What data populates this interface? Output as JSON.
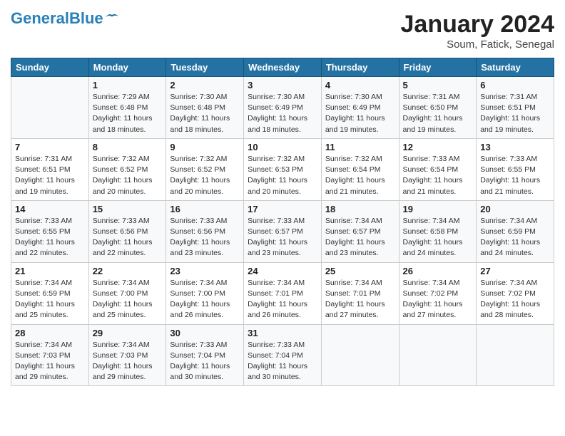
{
  "header": {
    "logo_line1": "General",
    "logo_line2": "Blue",
    "title": "January 2024",
    "subtitle": "Soum, Fatick, Senegal"
  },
  "weekdays": [
    "Sunday",
    "Monday",
    "Tuesday",
    "Wednesday",
    "Thursday",
    "Friday",
    "Saturday"
  ],
  "weeks": [
    [
      {
        "day": "",
        "info": ""
      },
      {
        "day": "1",
        "info": "Sunrise: 7:29 AM\nSunset: 6:48 PM\nDaylight: 11 hours\nand 18 minutes."
      },
      {
        "day": "2",
        "info": "Sunrise: 7:30 AM\nSunset: 6:48 PM\nDaylight: 11 hours\nand 18 minutes."
      },
      {
        "day": "3",
        "info": "Sunrise: 7:30 AM\nSunset: 6:49 PM\nDaylight: 11 hours\nand 18 minutes."
      },
      {
        "day": "4",
        "info": "Sunrise: 7:30 AM\nSunset: 6:49 PM\nDaylight: 11 hours\nand 19 minutes."
      },
      {
        "day": "5",
        "info": "Sunrise: 7:31 AM\nSunset: 6:50 PM\nDaylight: 11 hours\nand 19 minutes."
      },
      {
        "day": "6",
        "info": "Sunrise: 7:31 AM\nSunset: 6:51 PM\nDaylight: 11 hours\nand 19 minutes."
      }
    ],
    [
      {
        "day": "7",
        "info": "Sunrise: 7:31 AM\nSunset: 6:51 PM\nDaylight: 11 hours\nand 19 minutes."
      },
      {
        "day": "8",
        "info": "Sunrise: 7:32 AM\nSunset: 6:52 PM\nDaylight: 11 hours\nand 20 minutes."
      },
      {
        "day": "9",
        "info": "Sunrise: 7:32 AM\nSunset: 6:52 PM\nDaylight: 11 hours\nand 20 minutes."
      },
      {
        "day": "10",
        "info": "Sunrise: 7:32 AM\nSunset: 6:53 PM\nDaylight: 11 hours\nand 20 minutes."
      },
      {
        "day": "11",
        "info": "Sunrise: 7:32 AM\nSunset: 6:54 PM\nDaylight: 11 hours\nand 21 minutes."
      },
      {
        "day": "12",
        "info": "Sunrise: 7:33 AM\nSunset: 6:54 PM\nDaylight: 11 hours\nand 21 minutes."
      },
      {
        "day": "13",
        "info": "Sunrise: 7:33 AM\nSunset: 6:55 PM\nDaylight: 11 hours\nand 21 minutes."
      }
    ],
    [
      {
        "day": "14",
        "info": "Sunrise: 7:33 AM\nSunset: 6:55 PM\nDaylight: 11 hours\nand 22 minutes."
      },
      {
        "day": "15",
        "info": "Sunrise: 7:33 AM\nSunset: 6:56 PM\nDaylight: 11 hours\nand 22 minutes."
      },
      {
        "day": "16",
        "info": "Sunrise: 7:33 AM\nSunset: 6:56 PM\nDaylight: 11 hours\nand 23 minutes."
      },
      {
        "day": "17",
        "info": "Sunrise: 7:33 AM\nSunset: 6:57 PM\nDaylight: 11 hours\nand 23 minutes."
      },
      {
        "day": "18",
        "info": "Sunrise: 7:34 AM\nSunset: 6:57 PM\nDaylight: 11 hours\nand 23 minutes."
      },
      {
        "day": "19",
        "info": "Sunrise: 7:34 AM\nSunset: 6:58 PM\nDaylight: 11 hours\nand 24 minutes."
      },
      {
        "day": "20",
        "info": "Sunrise: 7:34 AM\nSunset: 6:59 PM\nDaylight: 11 hours\nand 24 minutes."
      }
    ],
    [
      {
        "day": "21",
        "info": "Sunrise: 7:34 AM\nSunset: 6:59 PM\nDaylight: 11 hours\nand 25 minutes."
      },
      {
        "day": "22",
        "info": "Sunrise: 7:34 AM\nSunset: 7:00 PM\nDaylight: 11 hours\nand 25 minutes."
      },
      {
        "day": "23",
        "info": "Sunrise: 7:34 AM\nSunset: 7:00 PM\nDaylight: 11 hours\nand 26 minutes."
      },
      {
        "day": "24",
        "info": "Sunrise: 7:34 AM\nSunset: 7:01 PM\nDaylight: 11 hours\nand 26 minutes."
      },
      {
        "day": "25",
        "info": "Sunrise: 7:34 AM\nSunset: 7:01 PM\nDaylight: 11 hours\nand 27 minutes."
      },
      {
        "day": "26",
        "info": "Sunrise: 7:34 AM\nSunset: 7:02 PM\nDaylight: 11 hours\nand 27 minutes."
      },
      {
        "day": "27",
        "info": "Sunrise: 7:34 AM\nSunset: 7:02 PM\nDaylight: 11 hours\nand 28 minutes."
      }
    ],
    [
      {
        "day": "28",
        "info": "Sunrise: 7:34 AM\nSunset: 7:03 PM\nDaylight: 11 hours\nand 29 minutes."
      },
      {
        "day": "29",
        "info": "Sunrise: 7:34 AM\nSunset: 7:03 PM\nDaylight: 11 hours\nand 29 minutes."
      },
      {
        "day": "30",
        "info": "Sunrise: 7:33 AM\nSunset: 7:04 PM\nDaylight: 11 hours\nand 30 minutes."
      },
      {
        "day": "31",
        "info": "Sunrise: 7:33 AM\nSunset: 7:04 PM\nDaylight: 11 hours\nand 30 minutes."
      },
      {
        "day": "",
        "info": ""
      },
      {
        "day": "",
        "info": ""
      },
      {
        "day": "",
        "info": ""
      }
    ]
  ]
}
